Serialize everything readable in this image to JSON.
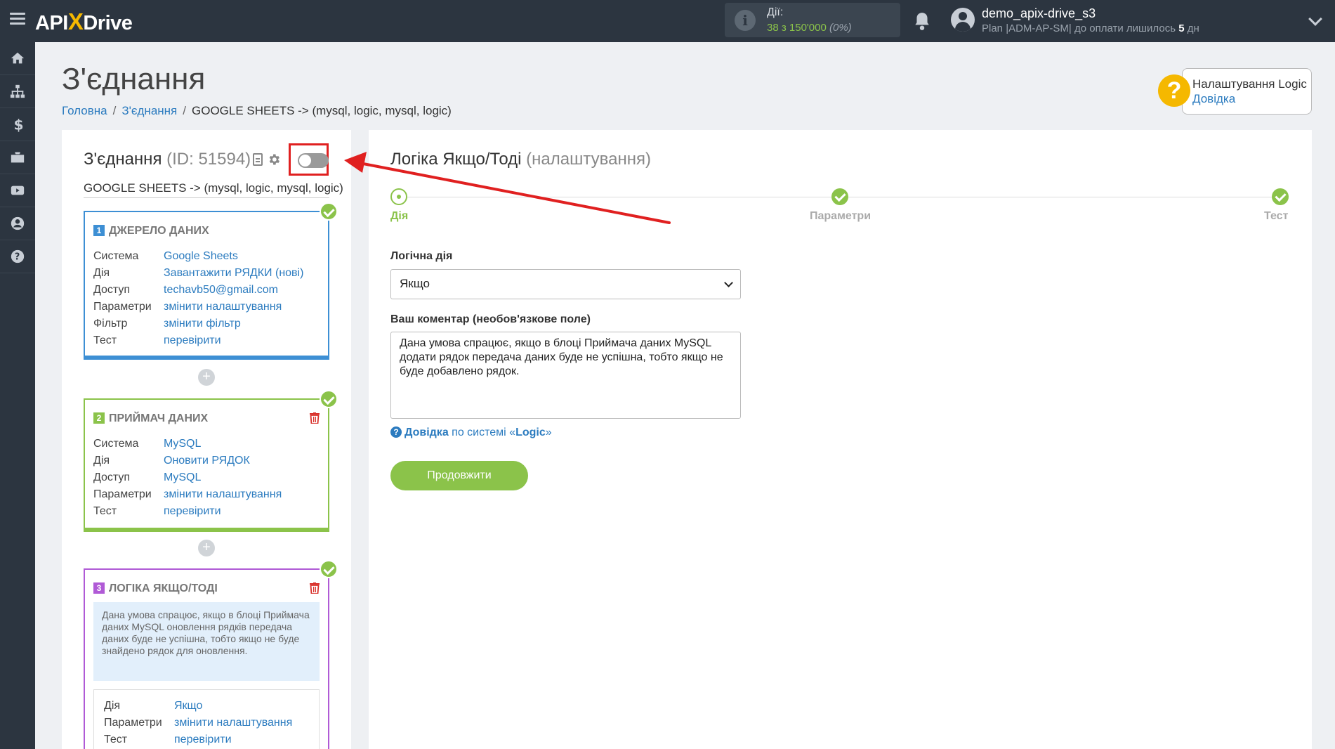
{
  "topbar": {
    "logo_left": "API",
    "logo_x": "X",
    "logo_right": "Drive",
    "actions_label": "Дії:",
    "actions_value": "38 з 150'000",
    "actions_percent": "(0%)",
    "user_name": "demo_apix-drive_s3",
    "user_plan_prefix": "Plan |ADM-AP-SM| до оплати лишилось ",
    "user_plan_days": "5",
    "user_plan_suffix": " дн"
  },
  "sidebar": {
    "items": [
      "home-icon",
      "sitemap-icon",
      "dollar-icon",
      "briefcase-icon",
      "video-icon",
      "user-icon",
      "help-icon"
    ]
  },
  "header": {
    "title": "З'єднання",
    "breadcrumb": {
      "home": "Головна",
      "connections": "З'єднання",
      "current": "GOOGLE SHEETS -> (mysql, logic, mysql, logic)"
    },
    "help_title": "Налаштування Logic",
    "help_link": "Довідка"
  },
  "left_panel": {
    "title": "З'єднання",
    "id_text": "(ID: 51594)",
    "subtitle": "GOOGLE SHEETS -> (mysql, logic, mysql, logic)",
    "toggle_on": false,
    "blocks": [
      {
        "num": "1",
        "title": "ДЖЕРЕЛО ДАНИХ",
        "color": "#3d8fd4",
        "rows": [
          {
            "k": "Система",
            "v": "Google Sheets"
          },
          {
            "k": "Дія",
            "v": "Завантажити РЯДКИ (нові)"
          },
          {
            "k": "Доступ",
            "v": "techavb50@gmail.com"
          },
          {
            "k": "Параметри",
            "v": "змінити налаштування"
          },
          {
            "k": "Фільтр",
            "v": "змінити фільтр"
          },
          {
            "k": "Тест",
            "v": "перевірити"
          }
        ]
      },
      {
        "num": "2",
        "title": "ПРИЙМАЧ ДАНИХ",
        "color": "#8bc34a",
        "rows": [
          {
            "k": "Система",
            "v": "MySQL"
          },
          {
            "k": "Дія",
            "v": "Оновити РЯДОК"
          },
          {
            "k": "Доступ",
            "v": "MySQL"
          },
          {
            "k": "Параметри",
            "v": "змінити налаштування"
          },
          {
            "k": "Тест",
            "v": "перевірити"
          }
        ]
      },
      {
        "num": "3",
        "title": "ЛОГІКА ЯКЩО/ТОДІ",
        "color": "#b05ad6",
        "note": "Дана умова спрацює, якщо в блоці Приймача даних MySQL оновлення рядків передача даних буде не успішна, тобто якщо не буде знайдено рядок для оновлення.",
        "rows": [
          {
            "k": "Дія",
            "v": "Якщо"
          },
          {
            "k": "Параметри",
            "v": "змінити налаштування"
          },
          {
            "k": "Тест",
            "v": "перевірити"
          }
        ]
      }
    ],
    "plus": "+"
  },
  "right_panel": {
    "title": "Логіка Якщо/Тоді",
    "title_muted": "(налаштування)",
    "steps": [
      {
        "label": "Дія",
        "state": "active"
      },
      {
        "label": "Параметри",
        "state": "done"
      },
      {
        "label": "Тест",
        "state": "done"
      }
    ],
    "action_label": "Логічна дія",
    "action_value": "Якщо",
    "comment_label": "Ваш коментар (необов'язкове поле)",
    "comment_value": "Дана умова спрацює, якщо в блоці Приймача даних MySQL додати рядок передача даних буде не успішна, тобто якщо не буде добавлено рядок.",
    "help_bold": "Довідка",
    "help_mid": " по системі «",
    "help_sys": "Logic",
    "help_end": "»",
    "continue_label": "Продовжити"
  },
  "colors": {
    "accent_green": "#8bc34a",
    "link_blue": "#2b7bbf",
    "annotation_red": "#e02020"
  }
}
